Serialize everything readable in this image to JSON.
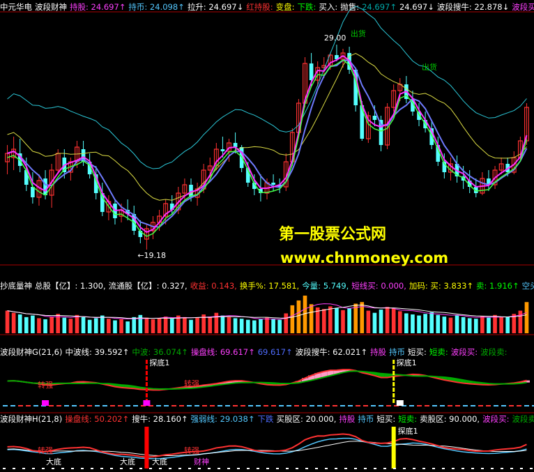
{
  "colors": {
    "up": "#ff3232",
    "down": "#54ffff",
    "yellow": "#ffff00",
    "magenta": "#ff00ff",
    "white": "#ffffff",
    "pink": "#ff9cc8",
    "green": "#00aa00",
    "blue": "#4f6cff",
    "orange": "#ff9900"
  },
  "watermark": {
    "line1": "第一股票公式网",
    "line2": "www.chnmoney.com"
  },
  "main": {
    "header": [
      {
        "text": "中元华电",
        "color": "#ffffff"
      },
      {
        "text": "波段财神",
        "color": "#ffffff"
      },
      {
        "text": "持股: 24.697↑",
        "color": "#ff40ff"
      },
      {
        "text": "持币: 24.098↑",
        "color": "#54c8ff"
      },
      {
        "text": "拉升: 24.697↓",
        "color": "#ffffff"
      },
      {
        "text": "红持股:",
        "color": "#ff3232"
      },
      {
        "text": "变盘:",
        "color": "#ffff00"
      },
      {
        "text": "下跌:",
        "color": "#00ff00"
      },
      {
        "text": "买入:",
        "color": "#ffffff"
      },
      {
        "text": "抛售:",
        "color": "#ffffff"
      },
      {
        "text": "24.697↑",
        "color": "#00aaaa"
      },
      {
        "text": "24.697↓",
        "color": "#ffffff"
      },
      {
        "text": "波段搜牛: 22.878↓",
        "color": "#ffffff"
      },
      {
        "text": "波段买",
        "color": "#ff40ff"
      }
    ],
    "annotations": {
      "high": "29.00",
      "low": "←19.18",
      "ship1": "出货",
      "ship2": "出货"
    }
  },
  "vol": {
    "header": [
      {
        "text": "抄底量神",
        "color": "#ffffff"
      },
      {
        "text": "总股【亿】: 1.300,",
        "color": "#ffffff"
      },
      {
        "text": "流通股【亿】: 0.327,",
        "color": "#ffffff"
      },
      {
        "text": "收益: 0.143,",
        "color": "#ff3232"
      },
      {
        "text": "换手%: 17.581,",
        "color": "#ffff00"
      },
      {
        "text": "今量: 5.749,",
        "color": "#54ffff"
      },
      {
        "text": "短线买: 0.000,",
        "color": "#ff40ff"
      },
      {
        "text": "加码: 买: 3.833↑",
        "color": "#ffff00"
      },
      {
        "text": "卖: 1.916↑",
        "color": "#00ff00"
      },
      {
        "text": "空头",
        "color": "#54c8ff"
      }
    ]
  },
  "g": {
    "header": [
      {
        "text": "波段财神G(21,6)",
        "color": "#ffffff"
      },
      {
        "text": "中波线: 39.592↑",
        "color": "#ffffff"
      },
      {
        "text": "中波: 36.074↑",
        "color": "#00aa00"
      },
      {
        "text": "操盘线: 69.617↑",
        "color": "#ff40ff"
      },
      {
        "text": "69.617↑",
        "color": "#4f6cff"
      },
      {
        "text": "波段搜牛: 62.021↑",
        "color": "#ffffff"
      },
      {
        "text": "持股",
        "color": "#ff40ff"
      },
      {
        "text": "持币",
        "color": "#54c8ff"
      },
      {
        "text": "短买:",
        "color": "#ffffff"
      },
      {
        "text": "短卖:",
        "color": "#00ff00"
      },
      {
        "text": "波段买:",
        "color": "#ff40ff"
      },
      {
        "text": "波段卖:",
        "color": "#00aa00"
      }
    ],
    "labels": {
      "probe": "探底1",
      "strong": "转强"
    }
  },
  "h": {
    "header": [
      {
        "text": "波段财神H(21,8)",
        "color": "#ffffff"
      },
      {
        "text": "操盘线: 50.202↑",
        "color": "#ff3232"
      },
      {
        "text": "搜牛: 28.160↑",
        "color": "#ffffff"
      },
      {
        "text": "强弱线: 29.038↑",
        "color": "#54c8ff"
      },
      {
        "text": "下跌",
        "color": "#4f6cff"
      },
      {
        "text": "买股区: 20.000,",
        "color": "#ffffff"
      },
      {
        "text": "持股",
        "color": "#ff40ff"
      },
      {
        "text": "持币",
        "color": "#54c8ff"
      },
      {
        "text": "短买:",
        "color": "#ffffff"
      },
      {
        "text": "短卖:",
        "color": "#00ff00"
      },
      {
        "text": "卖股区: 90.000,",
        "color": "#ffffff"
      },
      {
        "text": "波段买:",
        "color": "#ff40ff"
      },
      {
        "text": "波段卖:",
        "color": "#00aa00"
      }
    ],
    "labels": {
      "probe": "探底1",
      "strong": "转强",
      "bottom": "大底",
      "wealth": "财神"
    }
  },
  "chart_data": {
    "type": "candlestick",
    "price_range": [
      18.6,
      30.4
    ],
    "candles": [
      [
        23.4,
        24.2,
        22.8,
        23.8
      ],
      [
        23.6,
        24.6,
        23.0,
        24.0
      ],
      [
        23.8,
        24.5,
        22.9,
        23.2
      ],
      [
        23.0,
        23.6,
        22.0,
        22.3
      ],
      [
        22.2,
        22.9,
        21.4,
        21.7
      ],
      [
        21.7,
        22.8,
        21.3,
        22.5
      ],
      [
        22.6,
        23.0,
        21.6,
        21.8
      ],
      [
        21.8,
        23.3,
        21.2,
        23.0
      ],
      [
        23.0,
        24.0,
        22.8,
        23.8
      ],
      [
        23.6,
        24.0,
        22.6,
        22.9
      ],
      [
        22.9,
        23.6,
        22.5,
        23.4
      ],
      [
        23.4,
        24.4,
        23.1,
        24.1
      ],
      [
        24.0,
        24.4,
        23.2,
        23.4
      ],
      [
        23.4,
        23.8,
        22.6,
        22.8
      ],
      [
        22.8,
        23.2,
        21.6,
        21.9
      ],
      [
        21.9,
        22.4,
        20.8,
        21.0
      ],
      [
        21.0,
        21.8,
        20.6,
        21.5
      ],
      [
        21.4,
        21.6,
        20.4,
        20.7
      ],
      [
        20.8,
        21.4,
        20.5,
        21.1
      ],
      [
        21.1,
        21.6,
        20.6,
        20.9
      ],
      [
        20.9,
        21.3,
        19.9,
        20.1
      ],
      [
        20.1,
        20.6,
        19.5,
        19.8
      ],
      [
        19.7,
        20.4,
        19.2,
        20.2
      ],
      [
        20.1,
        20.8,
        19.7,
        20.5
      ],
      [
        20.5,
        21.1,
        20.1,
        20.8
      ],
      [
        20.8,
        21.6,
        20.4,
        21.4
      ],
      [
        21.4,
        21.8,
        20.9,
        21.1
      ],
      [
        21.1,
        22.2,
        20.9,
        21.9
      ],
      [
        21.9,
        22.6,
        21.6,
        22.3
      ],
      [
        22.3,
        22.6,
        21.5,
        21.7
      ],
      [
        21.7,
        22.4,
        21.3,
        22.1
      ],
      [
        22.1,
        23.3,
        21.9,
        23.0
      ],
      [
        23.0,
        23.6,
        22.6,
        23.2
      ],
      [
        23.2,
        24.3,
        23.0,
        24.0
      ],
      [
        24.0,
        24.6,
        23.6,
        23.9
      ],
      [
        23.9,
        24.5,
        23.4,
        24.3
      ],
      [
        24.3,
        24.8,
        23.8,
        24.1
      ],
      [
        24.1,
        24.2,
        22.9,
        23.1
      ],
      [
        23.1,
        23.4,
        22.2,
        22.4
      ],
      [
        22.4,
        22.8,
        21.8,
        22.1
      ],
      [
        22.1,
        22.8,
        21.5,
        21.9
      ],
      [
        21.9,
        22.6,
        21.6,
        22.4
      ],
      [
        22.4,
        22.8,
        22.0,
        22.3
      ],
      [
        22.3,
        22.6,
        21.9,
        22.2
      ],
      [
        22.2,
        23.8,
        22.0,
        23.4
      ],
      [
        23.4,
        25.0,
        23.2,
        24.8
      ],
      [
        24.8,
        26.4,
        24.6,
        26.2
      ],
      [
        26.2,
        28.4,
        26.0,
        28.1
      ],
      [
        28.1,
        28.6,
        27.0,
        27.3
      ],
      [
        27.3,
        28.2,
        27.0,
        27.9
      ],
      [
        27.9,
        28.4,
        27.4,
        28.0
      ],
      [
        28.0,
        28.6,
        27.8,
        28.5
      ],
      [
        28.5,
        29.0,
        28.2,
        28.3
      ],
      [
        28.3,
        28.8,
        27.9,
        28.6
      ],
      [
        28.6,
        28.9,
        27.6,
        27.8
      ],
      [
        27.8,
        27.9,
        25.8,
        26.1
      ],
      [
        26.1,
        26.3,
        24.4,
        24.5
      ],
      [
        24.5,
        25.8,
        24.3,
        25.6
      ],
      [
        25.6,
        26.1,
        25.1,
        25.4
      ],
      [
        25.4,
        25.6,
        23.9,
        24.2
      ],
      [
        24.2,
        26.2,
        24.0,
        26.0
      ],
      [
        26.0,
        27.1,
        25.8,
        26.8
      ],
      [
        26.8,
        27.4,
        26.3,
        27.1
      ],
      [
        27.1,
        27.5,
        26.2,
        26.4
      ],
      [
        26.4,
        26.8,
        25.6,
        25.8
      ],
      [
        25.8,
        26.2,
        25.1,
        25.4
      ],
      [
        25.4,
        25.8,
        24.8,
        25.0
      ],
      [
        25.0,
        25.4,
        24.0,
        24.2
      ],
      [
        24.2,
        24.6,
        23.2,
        23.4
      ],
      [
        23.4,
        23.8,
        22.6,
        22.9
      ],
      [
        22.9,
        23.6,
        22.5,
        23.3
      ],
      [
        23.3,
        23.7,
        22.4,
        22.7
      ],
      [
        22.7,
        23.2,
        22.1,
        22.5
      ],
      [
        22.5,
        23.0,
        21.9,
        22.2
      ],
      [
        22.2,
        22.6,
        21.7,
        21.9
      ],
      [
        21.9,
        22.9,
        21.8,
        22.6
      ],
      [
        22.6,
        23.0,
        22.0,
        22.3
      ],
      [
        22.3,
        23.2,
        22.1,
        23.0
      ],
      [
        23.0,
        23.6,
        22.8,
        23.3
      ],
      [
        23.3,
        23.6,
        22.7,
        22.9
      ],
      [
        22.9,
        23.9,
        22.8,
        23.6
      ],
      [
        23.6,
        24.6,
        23.4,
        24.4
      ],
      [
        24.4,
        26.2,
        24.2,
        26.0
      ]
    ],
    "volume": [
      42,
      38,
      35,
      30,
      33,
      28,
      26,
      31,
      36,
      29,
      27,
      34,
      30,
      25,
      28,
      33,
      27,
      24,
      26,
      22,
      30,
      34,
      29,
      26,
      28,
      31,
      27,
      33,
      30,
      25,
      29,
      35,
      31,
      38,
      33,
      30,
      28,
      27,
      25,
      24,
      26,
      29,
      27,
      25,
      37,
      52,
      61,
      70,
      54,
      48,
      45,
      50,
      47,
      43,
      46,
      55,
      58,
      42,
      38,
      44,
      49,
      46,
      41,
      37,
      35,
      33,
      36,
      39,
      34,
      31,
      29,
      33,
      30,
      28,
      27,
      32,
      29,
      34,
      31,
      30,
      36,
      42,
      58
    ]
  }
}
